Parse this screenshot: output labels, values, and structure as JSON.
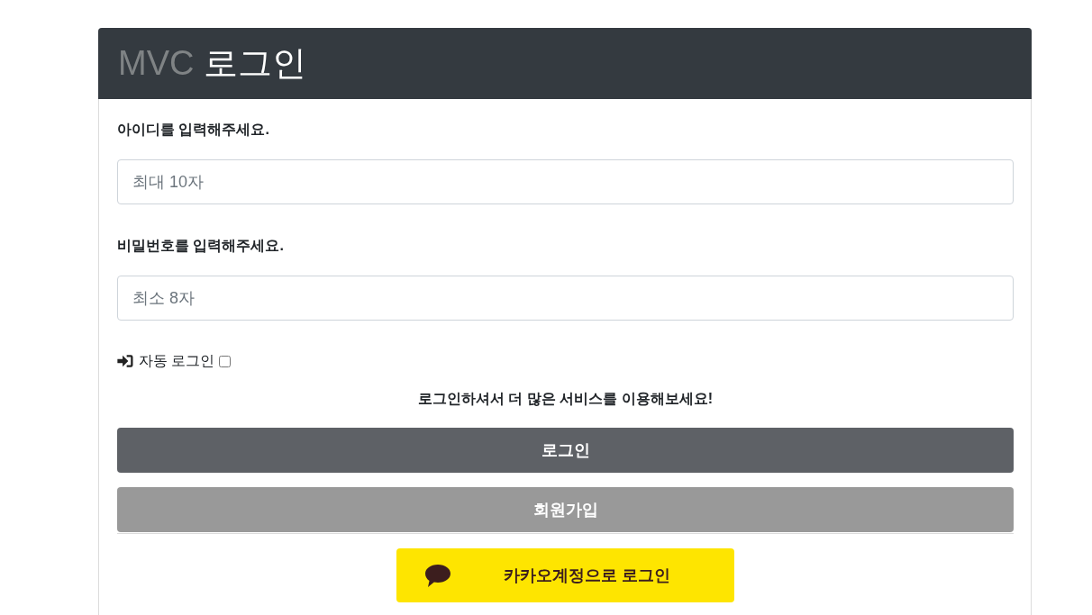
{
  "header": {
    "title_prefix": "MVC",
    "title": "로그인"
  },
  "fields": [
    {
      "label": "아이디를 입력해주세요.",
      "placeholder": "최대 10자"
    },
    {
      "label": "비밀번호를 입력해주세요.",
      "placeholder": "최소 8자"
    }
  ],
  "auto_login": {
    "label": "자동 로그인",
    "checked": false
  },
  "message": "로그인하셔서 더 많은 서비스를 이용해보세요!",
  "buttons": [
    {
      "label": "로그인",
      "kind": "primary"
    },
    {
      "label": "회원가입",
      "kind": "secondary"
    }
  ],
  "kakao_button": {
    "label": "카카오계정으로 로그인"
  }
}
